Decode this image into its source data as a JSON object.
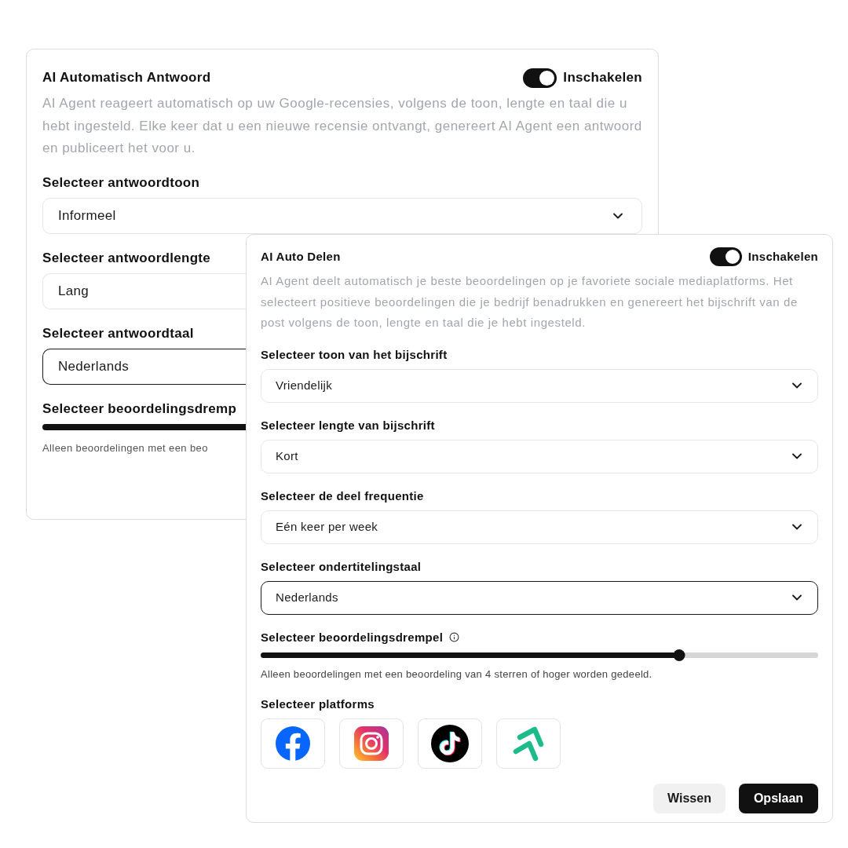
{
  "back_panel": {
    "title": "AI Automatisch Antwoord",
    "toggle": {
      "label": "Inschakelen",
      "on": true
    },
    "description": "AI Agent reageert automatisch op uw Google-recensies, volgens de toon, lengte en taal die u hebt ingesteld. Elke keer dat u een nieuwe recensie ontvangt, genereert AI Agent een antwoord en publiceert het voor u.",
    "selects": [
      {
        "label": "Selecteer antwoordtoon",
        "value": "Informeel",
        "focused": false
      },
      {
        "label": "Selecteer antwoordlengte",
        "value": "Lang",
        "focused": false
      },
      {
        "label": "Selecteer antwoordtaal",
        "value": "Nederlands",
        "focused": true
      }
    ],
    "threshold": {
      "label": "Selecteer beoordelingsdremp",
      "note": "Alleen beoordelingen met een beo"
    }
  },
  "front_panel": {
    "title": "AI Auto Delen",
    "toggle": {
      "label": "Inschakelen",
      "on": true
    },
    "description": "AI Agent deelt automatisch je beste beoordelingen op je favoriete sociale mediaplatforms. Het selecteert positieve beoordelingen die je bedrijf benadrukken en genereert het bijschrift van de post volgens de toon, lengte en taal die je hebt ingesteld.",
    "selects": [
      {
        "label": "Selecteer toon van het bijschrift",
        "value": "Vriendelijk",
        "focused": false
      },
      {
        "label": "Selecteer lengte van bijschrift",
        "value": "Kort",
        "focused": false
      },
      {
        "label": "Selecteer de deel frequentie",
        "value": "Eén keer per week",
        "focused": false
      },
      {
        "label": "Selecteer ondertitelingstaal",
        "value": "Nederlands",
        "focused": true
      }
    ],
    "threshold": {
      "label": "Selecteer beoordelingsdrempel",
      "level": 0.75,
      "note": "Alleen beoordelingen met een beoordeling van 4 sterren of hoger worden gedeeld."
    },
    "platforms": {
      "label": "Selecteer platforms",
      "items": [
        {
          "kind": "facebook"
        },
        {
          "kind": "instagram"
        },
        {
          "kind": "tiktok"
        },
        {
          "kind": "arrows"
        }
      ]
    },
    "buttons": [
      {
        "label": "Wissen",
        "kind": "secondary"
      },
      {
        "label": "Opslaan",
        "kind": "primary"
      }
    ]
  }
}
